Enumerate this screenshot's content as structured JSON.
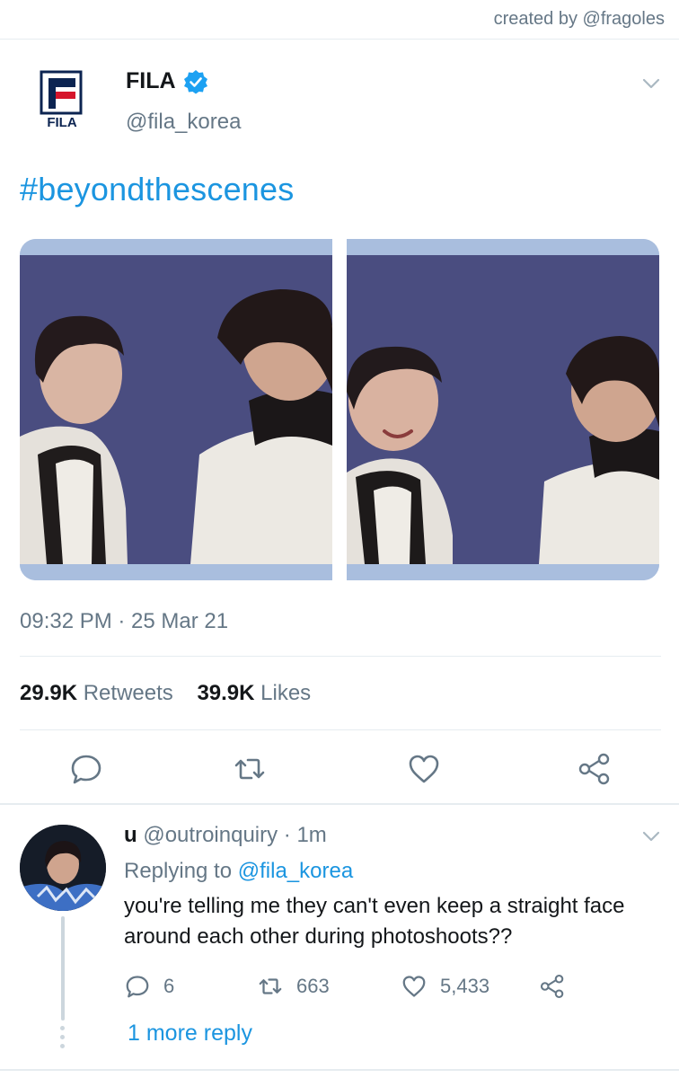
{
  "credit": "created by @fragoles",
  "tweet": {
    "author_name": "FILA",
    "author_handle": "@fila_korea",
    "logo_text": "FILA",
    "text": "#beyondthescenes",
    "timestamp": "09:32 PM · 25 Mar 21",
    "retweets_count": "29.9K",
    "retweets_label": "Retweets",
    "likes_count": "39.9K",
    "likes_label": "Likes"
  },
  "reply": {
    "name": "u",
    "handle": "@outroinquiry",
    "dot": "·",
    "time": "1m",
    "replying_prefix": "Replying to",
    "replying_to": "@fila_korea",
    "text": "you're telling me they can't even keep a straight face around each other during photoshoots??",
    "reply_count": "6",
    "retweet_count": "663",
    "like_count": "5,433",
    "more_replies": "1 more reply"
  },
  "colors": {
    "accent": "#1b95e0",
    "muted": "#657786",
    "divider": "#e6ecf0",
    "fila_red": "#d6152b",
    "fila_navy": "#0c2451"
  },
  "icons": [
    "fila-logo-icon",
    "verified-badge-icon",
    "chevron-down-icon",
    "reply-icon",
    "retweet-icon",
    "like-icon",
    "share-icon"
  ]
}
